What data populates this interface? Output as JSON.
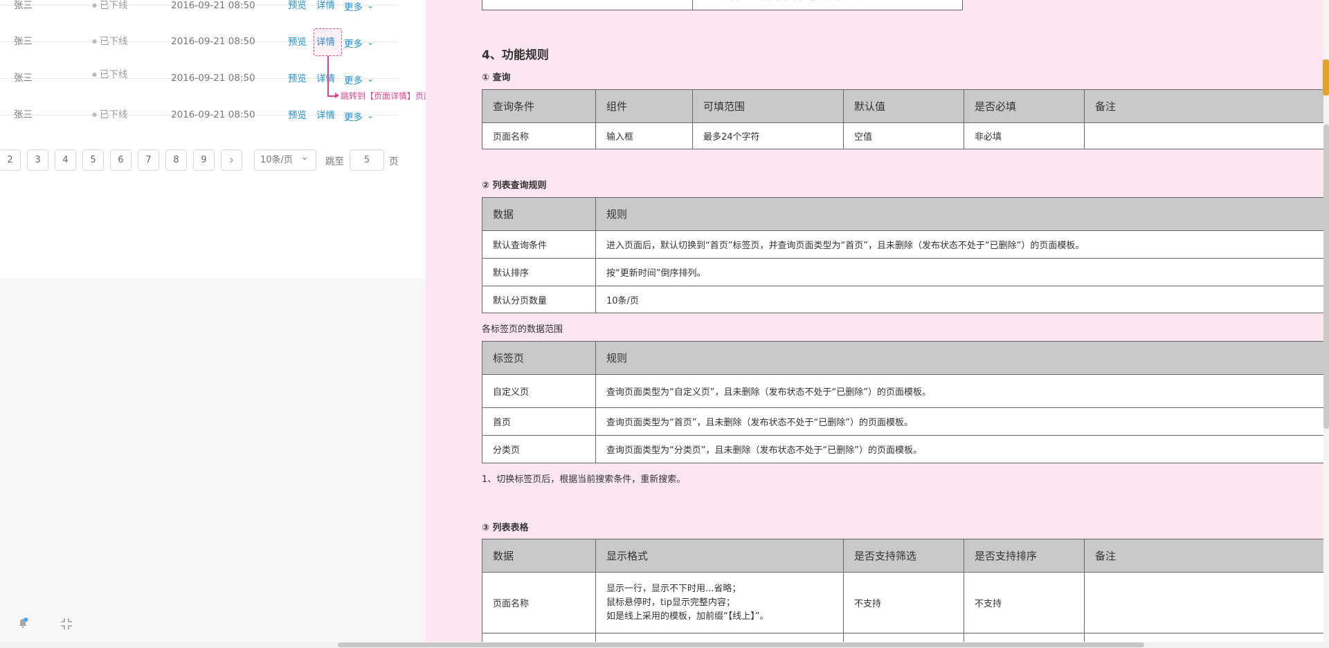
{
  "prototype": {
    "rows": [
      {
        "name": "张三",
        "status": "已下线",
        "date": "2016-09-21  08:50",
        "preview": "预览",
        "detail": "详情",
        "more": "更多"
      },
      {
        "name": "张三",
        "status": "已下线",
        "date": "2016-09-21  08:50",
        "preview": "预览",
        "detail": "详情",
        "more": "更多"
      },
      {
        "name": "张三",
        "status": "已下线",
        "date": "2016-09-21  08:50",
        "preview": "预览",
        "detail": "详情",
        "more": "更多"
      },
      {
        "name": "张三",
        "status": "已下线",
        "date": "2016-09-21  08:50",
        "preview": "预览",
        "detail": "详情",
        "more": "更多"
      }
    ],
    "annotation": "跳转到【页面详情】页面",
    "pagination": {
      "pages": [
        "2",
        "3",
        "4",
        "5",
        "6",
        "7",
        "8",
        "9"
      ],
      "next": "›",
      "page_size": "10条/页",
      "jump_label": "跳至",
      "jump_value": "5",
      "unit": "页"
    },
    "colors": {
      "link": "#1e8fe3",
      "annotation": "#e8408a"
    }
  },
  "doc": {
    "section_title": "4、功能规则",
    "query": {
      "title": "① 查询",
      "headers": [
        "查询条件",
        "组件",
        "可填范围",
        "默认值",
        "是否必填",
        "备注"
      ],
      "row": [
        "页面名称",
        "输入框",
        "最多24个字符",
        "空值",
        "非必填",
        ""
      ]
    },
    "list_rules": {
      "title": "② 列表查询规则",
      "headers": [
        "数据",
        "规则"
      ],
      "rows": [
        [
          "默认查询条件",
          "进入页面后，默认切换到“首页”标签页，并查询页面类型为“首页”，且未删除（发布状态不处于“已删除”）的页面模板。"
        ],
        [
          "默认排序",
          "按“更新时间”倒序排列。"
        ],
        [
          "默认分页数量",
          "10条/页"
        ]
      ]
    },
    "tab_scope": {
      "caption": "各标签页的数据范围",
      "headers": [
        "标签页",
        "规则"
      ],
      "rows": [
        [
          "自定义页",
          "查询页面类型为“自定义页”，且未删除（发布状态不处于“已删除”）的页面模板。"
        ],
        [
          "首页",
          "查询页面类型为“首页”，且未删除（发布状态不处于“已删除”）的页面模板。"
        ],
        [
          "分类页",
          "查询页面类型为“分类页”，且未删除（发布状态不处于“已删除”）的页面模板。"
        ]
      ],
      "note": "1、切换标签页后，根据当前搜索条件，重新搜索。"
    },
    "list_table": {
      "title": "③ 列表表格",
      "headers": [
        "数据",
        "显示格式",
        "是否支持筛选",
        "是否支持排序",
        "备注"
      ],
      "row_name": "页面名称",
      "row_format": [
        "显示一行，显示不下时用...省略；",
        "鼠标悬停时，tip显示完整内容；",
        "如是线上采用的模板，加前缀“【线上】”。"
      ],
      "row_filter": "不支持",
      "row_sort": "不支持",
      "row_note": ""
    },
    "top_fragment": "显示页面的全部模板，需要按页面类型筛选",
    "background": "#fbe5f0"
  },
  "icons": {
    "notify": "bell-icon",
    "collapse": "collapse-icon"
  }
}
